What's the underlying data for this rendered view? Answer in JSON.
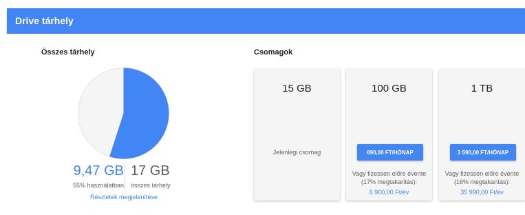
{
  "header": {
    "title": "Drive tárhely"
  },
  "storage": {
    "title": "Összes tárhely",
    "used_value": "9,47 GB",
    "used_caption": "55% használatban",
    "total_value": "17 GB",
    "total_caption": "összes tárhely",
    "details_link": "Részletek megjelenítése",
    "used_fraction": 0.55,
    "colors": {
      "used": "#4285f4",
      "free": "#f5f5f5"
    }
  },
  "plans": {
    "title": "Csomagok",
    "items": [
      {
        "size": "15 GB",
        "current_label": "Jelenlegi csomag"
      },
      {
        "size": "100 GB",
        "button": "690,00 FT/HÓNAP",
        "yearly_line1": "Vagy fizessen előre évente",
        "yearly_line2": "(17% megtakarítás):",
        "yearly_price": "6 900,00 Ft/év"
      },
      {
        "size": "1 TB",
        "button": "3 590,00 FT/HÓNAP",
        "yearly_line1": "Vagy fizessen előre évente",
        "yearly_line2": "(16% megtakarítás):",
        "yearly_price": "35 990,00 Ft/év"
      }
    ]
  },
  "accent_color": "#4285f4"
}
